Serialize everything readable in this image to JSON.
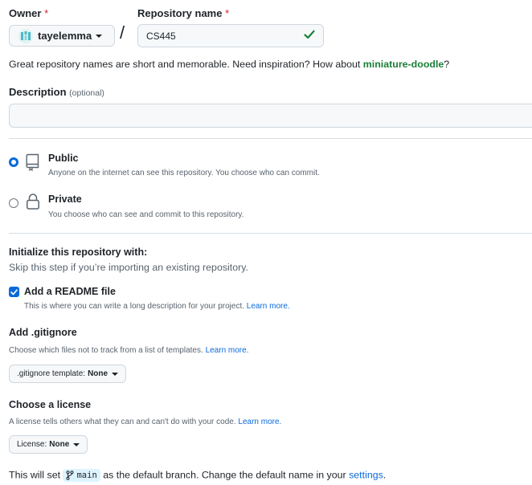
{
  "owner": {
    "label": "Owner",
    "required_mark": "*",
    "selected": "tayelemma"
  },
  "repo": {
    "label": "Repository name",
    "required_mark": "*",
    "value": "CS445",
    "separator": "/"
  },
  "name_hint": {
    "text": "Great repository names are short and memorable. Need inspiration? How about ",
    "suggestion": "miniature-doodle",
    "suffix": "?"
  },
  "description": {
    "label": "Description",
    "optional": "(optional)",
    "value": ""
  },
  "visibility": {
    "public": {
      "title": "Public",
      "subtitle": "Anyone on the internet can see this repository. You choose who can commit.",
      "checked": true
    },
    "private": {
      "title": "Private",
      "subtitle": "You choose who can see and commit to this repository.",
      "checked": false
    }
  },
  "init": {
    "title": "Initialize this repository with:",
    "subtitle": "Skip this step if you’re importing an existing repository.",
    "readme": {
      "label": "Add a README file",
      "description": "This is where you can write a long description for your project.",
      "learn_more": "Learn more.",
      "checked": true
    },
    "gitignore": {
      "title": "Add .gitignore",
      "description": "Choose which files not to track from a list of templates.",
      "learn_more": "Learn more.",
      "button_prefix": ".gitignore template:",
      "button_value": "None"
    },
    "license": {
      "title": "Choose a license",
      "description": "A license tells others what they can and can't do with your code.",
      "learn_more": "Learn more.",
      "button_prefix": "License:",
      "button_value": "None"
    }
  },
  "branch_note": {
    "prefix": "This will set",
    "branch": "main",
    "middle": "as the default branch. Change the default name in your",
    "link": "settings",
    "suffix": "."
  },
  "colors": {
    "accent": "#0969da",
    "success": "#1a7f37",
    "danger": "#cf222e",
    "border": "#d0d7de"
  },
  "icons": {
    "avatar": "identicon-avatar",
    "check": "check-icon",
    "public": "repo-icon",
    "private": "lock-icon",
    "branch": "git-branch-icon",
    "caret": "triangle-down-icon"
  }
}
